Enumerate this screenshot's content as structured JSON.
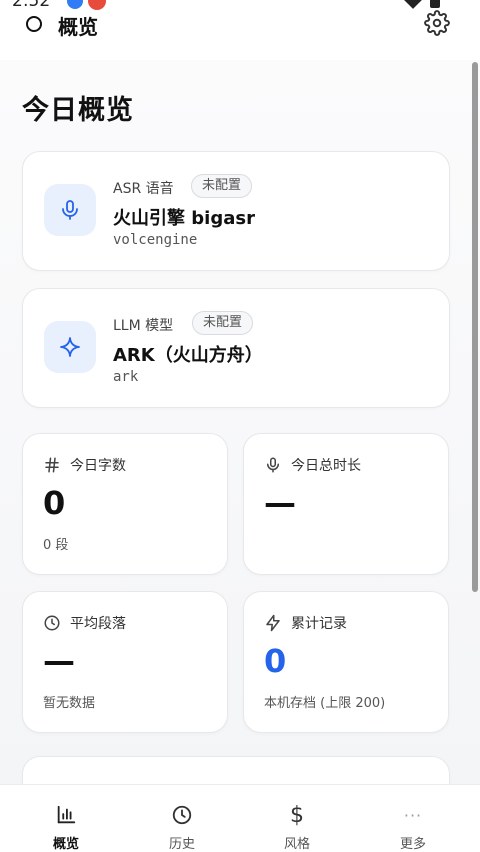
{
  "status_bar": {
    "time": "2:52"
  },
  "header": {
    "title": "概览"
  },
  "page": {
    "title": "今日概览"
  },
  "engines": [
    {
      "kind": "ASR 语音",
      "badge": "未配置",
      "name": "火山引擎 bigasr",
      "id": "volcengine",
      "icon": "mic-icon"
    },
    {
      "kind": "LLM 模型",
      "badge": "未配置",
      "name": "ARK（火山方舟）",
      "id": "ark",
      "icon": "sparkle-icon"
    }
  ],
  "stats": [
    {
      "label": "今日字数",
      "value": "0",
      "sub": "0 段",
      "icon": "hash-icon"
    },
    {
      "label": "今日总时长",
      "value": "—",
      "sub": "",
      "icon": "mic-icon"
    },
    {
      "label": "平均段落",
      "value": "—",
      "sub": "暂无数据",
      "icon": "clock-icon"
    },
    {
      "label": "累计记录",
      "value": "0",
      "sub": "本机存档 (上限 200)",
      "icon": "bolt-icon"
    }
  ],
  "nav": [
    {
      "label": "概览",
      "icon": "bar-chart-icon",
      "active": true
    },
    {
      "label": "历史",
      "icon": "clock-icon"
    },
    {
      "label": "风格",
      "icon": "dollar-icon"
    },
    {
      "label": "更多",
      "icon": "more-icon"
    }
  ],
  "colors": {
    "accent": "#2563eb",
    "icon_bg": "#e9f0fd"
  }
}
